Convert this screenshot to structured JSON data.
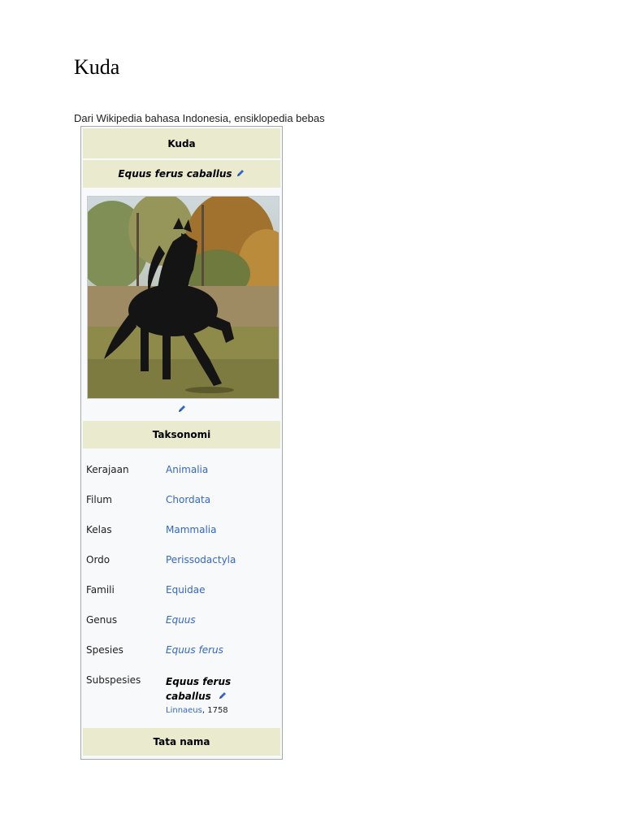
{
  "page": {
    "title": "Kuda",
    "tagline": "Dari Wikipedia bahasa Indonesia, ensiklopedia bebas"
  },
  "infobox": {
    "title": "Kuda",
    "scientific_name": "Equus ferus caballus",
    "image_icon": "horse-photo",
    "edit_icon": "pencil-icon",
    "taxonomy_header": "Taksonomi",
    "taxonomy": [
      {
        "rank": "Kerajaan",
        "value": "Animalia",
        "italic": false
      },
      {
        "rank": "Filum",
        "value": "Chordata",
        "italic": false
      },
      {
        "rank": "Kelas",
        "value": "Mammalia",
        "italic": false
      },
      {
        "rank": "Ordo",
        "value": "Perissodactyla",
        "italic": false
      },
      {
        "rank": "Famili",
        "value": "Equidae",
        "italic": false
      },
      {
        "rank": "Genus",
        "value": "Equus",
        "italic": true
      },
      {
        "rank": "Spesies",
        "value": "Equus ferus",
        "italic": true
      }
    ],
    "subspecies": {
      "rank": "Subspesies",
      "name_line1": "Equus ferus",
      "name_line2": "caballus",
      "author": "Linnaeus",
      "year": ", 1758"
    },
    "naming_header": "Tata nama"
  },
  "colors": {
    "header_bg": "#eaeacf",
    "link": "#3366cc",
    "box_bg": "#f8f9fa",
    "border": "#a2a9b1"
  }
}
